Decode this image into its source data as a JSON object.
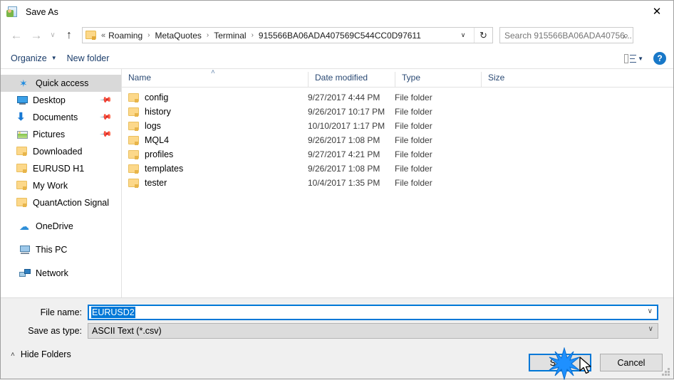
{
  "window": {
    "title": "Save As",
    "title_icon": "save-as-icon",
    "close_label": "✕"
  },
  "nav": {
    "back_icon": "←",
    "forward_icon": "→",
    "recent_icon": "∨",
    "up_icon": "↑",
    "address": {
      "folder_icon": "folder-icon",
      "lead": "«",
      "crumbs": [
        "Roaming",
        "MetaQuotes",
        "Terminal",
        "915566BA06ADA407569C544CC0D97611"
      ],
      "separator": "›",
      "dropdown_icon": "∨",
      "refresh_icon": "↻"
    },
    "search": {
      "placeholder": "Search 915566BA06ADA40756...",
      "icon": "⌕"
    }
  },
  "toolbar": {
    "organize_label": "Organize",
    "organize_caret": "▼",
    "new_folder_label": "New folder",
    "view_caret": "▼",
    "help_label": "?"
  },
  "sidebar": {
    "items": [
      {
        "label": "Quick access",
        "icon": "star-icon",
        "selected": true,
        "pinned": false,
        "indent": "root"
      },
      {
        "label": "Desktop",
        "icon": "desktop-icon",
        "selected": false,
        "pinned": true,
        "indent": "child"
      },
      {
        "label": "Documents",
        "icon": "documents-icon",
        "selected": false,
        "pinned": true,
        "indent": "child"
      },
      {
        "label": "Pictures",
        "icon": "pictures-icon",
        "selected": false,
        "pinned": true,
        "indent": "child"
      },
      {
        "label": "Downloaded",
        "icon": "folder-icon",
        "selected": false,
        "pinned": false,
        "indent": "child"
      },
      {
        "label": "EURUSD H1",
        "icon": "folder-icon",
        "selected": false,
        "pinned": false,
        "indent": "child"
      },
      {
        "label": "My Work",
        "icon": "folder-icon",
        "selected": false,
        "pinned": false,
        "indent": "child"
      },
      {
        "label": "QuantAction Signal",
        "icon": "folder-icon",
        "selected": false,
        "pinned": false,
        "indent": "child"
      },
      {
        "label": "OneDrive",
        "icon": "cloud-icon",
        "selected": false,
        "pinned": false,
        "indent": "root"
      },
      {
        "label": "This PC",
        "icon": "pc-icon",
        "selected": false,
        "pinned": false,
        "indent": "root"
      },
      {
        "label": "Network",
        "icon": "network-icon",
        "selected": false,
        "pinned": false,
        "indent": "root"
      }
    ],
    "pin_glyph": "📌"
  },
  "filelist": {
    "columns": [
      "Name",
      "Date modified",
      "Type",
      "Size"
    ],
    "sort_caret": "˄",
    "rows": [
      {
        "name": "config",
        "date": "9/27/2017 4:44 PM",
        "type": "File folder",
        "size": ""
      },
      {
        "name": "history",
        "date": "9/26/2017 10:17 PM",
        "type": "File folder",
        "size": ""
      },
      {
        "name": "logs",
        "date": "10/10/2017 1:17 PM",
        "type": "File folder",
        "size": ""
      },
      {
        "name": "MQL4",
        "date": "9/26/2017 1:08 PM",
        "type": "File folder",
        "size": ""
      },
      {
        "name": "profiles",
        "date": "9/27/2017 4:21 PM",
        "type": "File folder",
        "size": ""
      },
      {
        "name": "templates",
        "date": "9/26/2017 1:08 PM",
        "type": "File folder",
        "size": ""
      },
      {
        "name": "tester",
        "date": "10/4/2017 1:35 PM",
        "type": "File folder",
        "size": ""
      }
    ]
  },
  "form": {
    "filename_label": "File name:",
    "filename_value": "EURUSD2",
    "filetype_label": "Save as type:",
    "filetype_value": "ASCII Text (*.csv)",
    "dropdown_icon": "∨"
  },
  "footer": {
    "hide_folders_label": "Hide Folders",
    "hide_folders_caret": "˄",
    "save_label": "Save",
    "cancel_label": "Cancel"
  },
  "colors": {
    "accent": "#0078d7",
    "folder": "#fcd88a",
    "header_text": "#2b4a74",
    "selection": "#d9d9d9",
    "help_blue": "#1878c8"
  }
}
